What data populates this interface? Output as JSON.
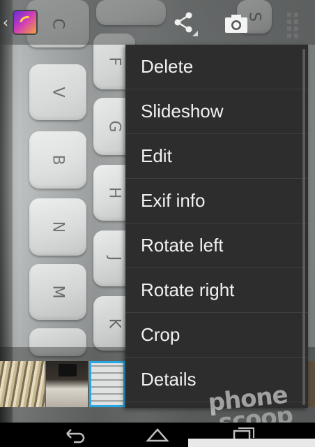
{
  "menu": {
    "items": [
      {
        "label": "Delete"
      },
      {
        "label": "Slideshow"
      },
      {
        "label": "Edit"
      },
      {
        "label": "Exif info"
      },
      {
        "label": "Rotate left"
      },
      {
        "label": "Rotate right"
      },
      {
        "label": "Crop"
      },
      {
        "label": "Details"
      }
    ]
  },
  "photo": {
    "keys": [
      "C",
      "V",
      "B",
      "N",
      "M",
      "F",
      "G",
      "H",
      "J",
      "K",
      "S"
    ]
  },
  "actionbar": {
    "icons": [
      "back-caret-icon",
      "gallery-app-icon",
      "share-icon",
      "camera-icon",
      "overflow-menu-icon"
    ]
  },
  "watermark": {
    "line1": "phone",
    "line2": "scoop"
  },
  "navbar": {
    "icons": [
      "back-icon",
      "home-icon",
      "recent-apps-icon"
    ]
  },
  "colors": {
    "menu_bg": "#2d2d2d",
    "menu_text": "#f1f1f1",
    "selected_thumb": "#2aa6e0"
  }
}
